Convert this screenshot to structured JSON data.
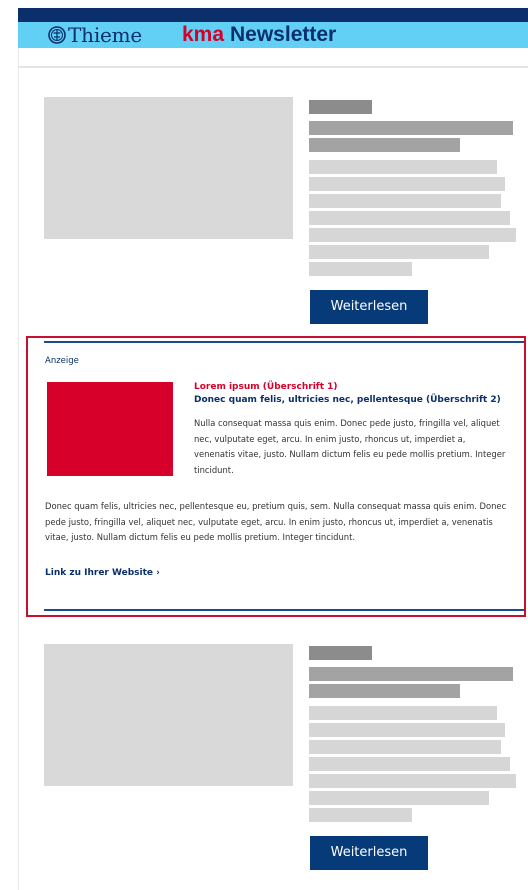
{
  "header": {
    "brand": "Thieme",
    "product_prefix": "kma",
    "product_name": "Newsletter",
    "icon": "thieme-logo-icon",
    "colors": {
      "top_bar": "#0a2f6a",
      "header_bar": "#62d0f5",
      "brand": "#0a2f6a",
      "accent_red": "#d6002a"
    }
  },
  "articles": [
    {
      "button_label": "Weiterlesen"
    },
    {
      "button_label": "Weiterlesen"
    }
  ],
  "ad": {
    "label": "Anzeige",
    "heading1": "Lorem ipsum (Überschrift 1)",
    "heading2": "Donec quam felis, ultricies nec, pellentesque (Überschrift 2)",
    "paragraph1": "Nulla consequat massa quis enim. Donec pede justo, fringilla vel, aliquet nec, vulputate eget, arcu. In enim justo, rhoncus ut, imperdiet a, venenatis vitae, justo. Nullam dictum felis eu pede mollis pretium. Integer tincidunt.",
    "paragraph2": "Donec quam felis, ultricies nec, pellentesque eu, pretium quis, sem. Nulla consequat massa quis enim. Donec pede justo, fringilla vel, aliquet nec, vulputate eget, arcu. In enim justo, rhoncus ut, imperdiet a, venenatis vitae, justo. Nullam dictum felis eu pede mollis pretium. Integer tincidunt.",
    "link_text": "Link zu Ihrer Website ›",
    "colors": {
      "border": "#c8102e",
      "rule": "#1b4c8f",
      "image": "#d6002a"
    }
  }
}
